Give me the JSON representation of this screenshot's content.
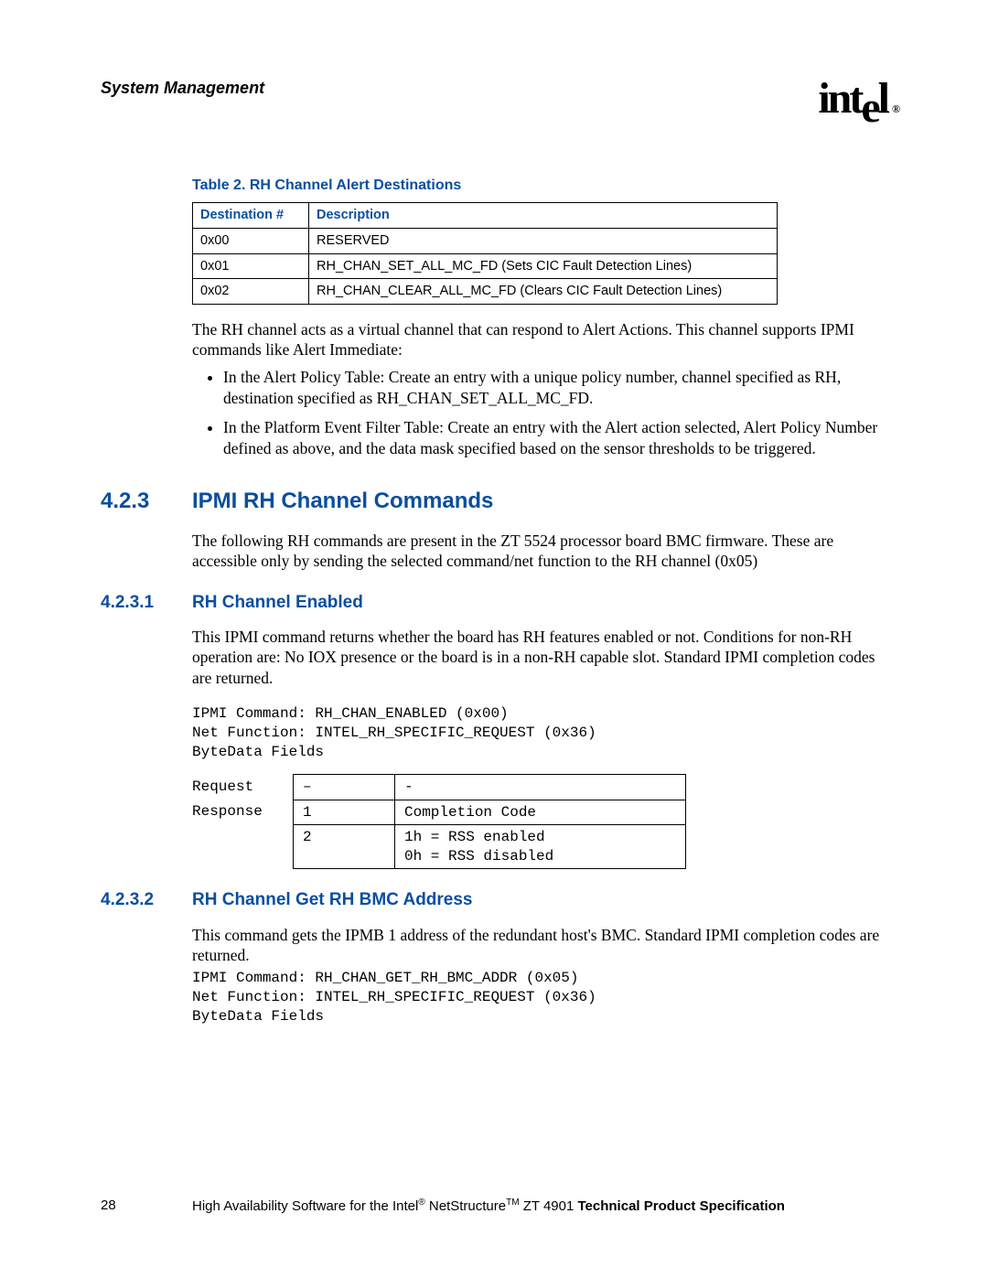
{
  "header": {
    "title": "System Management",
    "logo_text": "intel",
    "logo_reg": "®"
  },
  "table2": {
    "caption": "Table 2.   RH Channel Alert Destinations",
    "cols": [
      "Destination #",
      "Description"
    ],
    "rows": [
      [
        "0x00",
        "RESERVED"
      ],
      [
        "0x01",
        "RH_CHAN_SET_ALL_MC_FD (Sets CIC Fault Detection Lines)"
      ],
      [
        "0x02",
        "RH_CHAN_CLEAR_ALL_MC_FD (Clears CIC Fault Detection Lines)"
      ]
    ]
  },
  "para1": "The RH channel acts as a virtual channel that can respond to Alert Actions. This channel supports IPMI commands like Alert Immediate:",
  "bullets": [
    "In the Alert Policy Table: Create an entry with a unique policy number, channel specified as RH, destination specified as RH_CHAN_SET_ALL_MC_FD.",
    "In the Platform Event Filter Table: Create an entry with the Alert action selected, Alert Policy Number defined as above, and the data mask specified based on the sensor thresholds to be triggered."
  ],
  "sec423": {
    "num": "4.2.3",
    "title": "IPMI RH Channel Commands",
    "para": "The following RH commands are present in the ZT 5524 processor board BMC firmware. These are accessible only by sending the selected command/net function to the RH channel (0x05)"
  },
  "sec4231": {
    "num": "4.2.3.1",
    "title": "RH Channel Enabled",
    "para": "This IPMI command returns whether the board has RH features enabled or not. Conditions for non-RH operation are: No IOX presence or the board is in a non-RH capable slot. Standard IPMI completion codes are returned.",
    "mono": "IPMI Command: RH_CHAN_ENABLED (0x00)\nNet Function: INTEL_RH_SPECIFIC_REQUEST (0x36)\nByteData Fields",
    "byte_request_label": "Request",
    "byte_response_label": "Response",
    "byte_rows": [
      {
        "label": "Request",
        "n": "–",
        "desc": "-"
      },
      {
        "label": "Response",
        "n": "1",
        "desc": "Completion Code"
      },
      {
        "label": "",
        "n": "2",
        "desc": "1h = RSS enabled\n0h = RSS disabled"
      }
    ]
  },
  "sec4232": {
    "num": "4.2.3.2",
    "title": "RH Channel Get RH BMC Address",
    "para": "This command gets the IPMB 1 address of the redundant host's BMC. Standard IPMI completion codes are returned.",
    "mono": "IPMI Command: RH_CHAN_GET_RH_BMC_ADDR (0x05)\nNet Function: INTEL_RH_SPECIFIC_REQUEST (0x36)\nByteData Fields"
  },
  "footer": {
    "page": "28",
    "text_prefix": "High Availability Software for the Intel",
    "reg": "®",
    "text_mid": " NetStructure",
    "tm": "TM",
    "text_suffix": " ZT 4901 ",
    "bold": "Technical Product Specification"
  }
}
